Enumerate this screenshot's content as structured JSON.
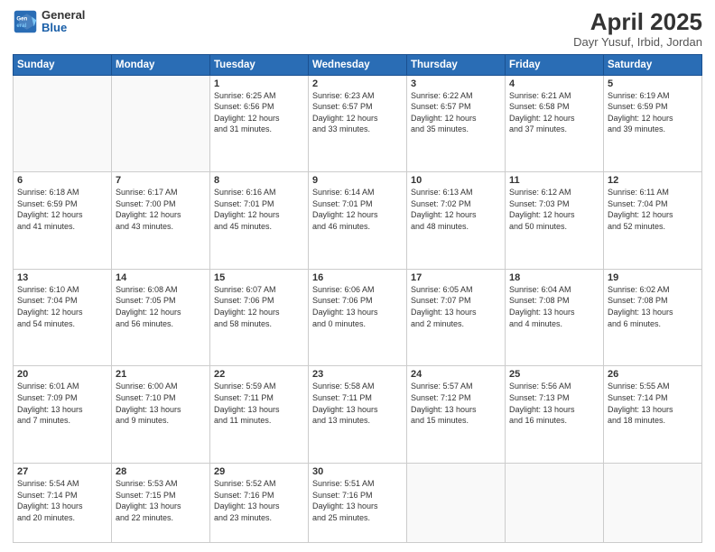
{
  "header": {
    "logo_general": "General",
    "logo_blue": "Blue",
    "title": "April 2025",
    "subtitle": "Dayr Yusuf, Irbid, Jordan"
  },
  "days_of_week": [
    "Sunday",
    "Monday",
    "Tuesday",
    "Wednesday",
    "Thursday",
    "Friday",
    "Saturday"
  ],
  "weeks": [
    [
      {
        "day": "",
        "info": ""
      },
      {
        "day": "",
        "info": ""
      },
      {
        "day": "1",
        "info": "Sunrise: 6:25 AM\nSunset: 6:56 PM\nDaylight: 12 hours\nand 31 minutes."
      },
      {
        "day": "2",
        "info": "Sunrise: 6:23 AM\nSunset: 6:57 PM\nDaylight: 12 hours\nand 33 minutes."
      },
      {
        "day": "3",
        "info": "Sunrise: 6:22 AM\nSunset: 6:57 PM\nDaylight: 12 hours\nand 35 minutes."
      },
      {
        "day": "4",
        "info": "Sunrise: 6:21 AM\nSunset: 6:58 PM\nDaylight: 12 hours\nand 37 minutes."
      },
      {
        "day": "5",
        "info": "Sunrise: 6:19 AM\nSunset: 6:59 PM\nDaylight: 12 hours\nand 39 minutes."
      }
    ],
    [
      {
        "day": "6",
        "info": "Sunrise: 6:18 AM\nSunset: 6:59 PM\nDaylight: 12 hours\nand 41 minutes."
      },
      {
        "day": "7",
        "info": "Sunrise: 6:17 AM\nSunset: 7:00 PM\nDaylight: 12 hours\nand 43 minutes."
      },
      {
        "day": "8",
        "info": "Sunrise: 6:16 AM\nSunset: 7:01 PM\nDaylight: 12 hours\nand 45 minutes."
      },
      {
        "day": "9",
        "info": "Sunrise: 6:14 AM\nSunset: 7:01 PM\nDaylight: 12 hours\nand 46 minutes."
      },
      {
        "day": "10",
        "info": "Sunrise: 6:13 AM\nSunset: 7:02 PM\nDaylight: 12 hours\nand 48 minutes."
      },
      {
        "day": "11",
        "info": "Sunrise: 6:12 AM\nSunset: 7:03 PM\nDaylight: 12 hours\nand 50 minutes."
      },
      {
        "day": "12",
        "info": "Sunrise: 6:11 AM\nSunset: 7:04 PM\nDaylight: 12 hours\nand 52 minutes."
      }
    ],
    [
      {
        "day": "13",
        "info": "Sunrise: 6:10 AM\nSunset: 7:04 PM\nDaylight: 12 hours\nand 54 minutes."
      },
      {
        "day": "14",
        "info": "Sunrise: 6:08 AM\nSunset: 7:05 PM\nDaylight: 12 hours\nand 56 minutes."
      },
      {
        "day": "15",
        "info": "Sunrise: 6:07 AM\nSunset: 7:06 PM\nDaylight: 12 hours\nand 58 minutes."
      },
      {
        "day": "16",
        "info": "Sunrise: 6:06 AM\nSunset: 7:06 PM\nDaylight: 13 hours\nand 0 minutes."
      },
      {
        "day": "17",
        "info": "Sunrise: 6:05 AM\nSunset: 7:07 PM\nDaylight: 13 hours\nand 2 minutes."
      },
      {
        "day": "18",
        "info": "Sunrise: 6:04 AM\nSunset: 7:08 PM\nDaylight: 13 hours\nand 4 minutes."
      },
      {
        "day": "19",
        "info": "Sunrise: 6:02 AM\nSunset: 7:08 PM\nDaylight: 13 hours\nand 6 minutes."
      }
    ],
    [
      {
        "day": "20",
        "info": "Sunrise: 6:01 AM\nSunset: 7:09 PM\nDaylight: 13 hours\nand 7 minutes."
      },
      {
        "day": "21",
        "info": "Sunrise: 6:00 AM\nSunset: 7:10 PM\nDaylight: 13 hours\nand 9 minutes."
      },
      {
        "day": "22",
        "info": "Sunrise: 5:59 AM\nSunset: 7:11 PM\nDaylight: 13 hours\nand 11 minutes."
      },
      {
        "day": "23",
        "info": "Sunrise: 5:58 AM\nSunset: 7:11 PM\nDaylight: 13 hours\nand 13 minutes."
      },
      {
        "day": "24",
        "info": "Sunrise: 5:57 AM\nSunset: 7:12 PM\nDaylight: 13 hours\nand 15 minutes."
      },
      {
        "day": "25",
        "info": "Sunrise: 5:56 AM\nSunset: 7:13 PM\nDaylight: 13 hours\nand 16 minutes."
      },
      {
        "day": "26",
        "info": "Sunrise: 5:55 AM\nSunset: 7:14 PM\nDaylight: 13 hours\nand 18 minutes."
      }
    ],
    [
      {
        "day": "27",
        "info": "Sunrise: 5:54 AM\nSunset: 7:14 PM\nDaylight: 13 hours\nand 20 minutes."
      },
      {
        "day": "28",
        "info": "Sunrise: 5:53 AM\nSunset: 7:15 PM\nDaylight: 13 hours\nand 22 minutes."
      },
      {
        "day": "29",
        "info": "Sunrise: 5:52 AM\nSunset: 7:16 PM\nDaylight: 13 hours\nand 23 minutes."
      },
      {
        "day": "30",
        "info": "Sunrise: 5:51 AM\nSunset: 7:16 PM\nDaylight: 13 hours\nand 25 minutes."
      },
      {
        "day": "",
        "info": ""
      },
      {
        "day": "",
        "info": ""
      },
      {
        "day": "",
        "info": ""
      }
    ]
  ]
}
